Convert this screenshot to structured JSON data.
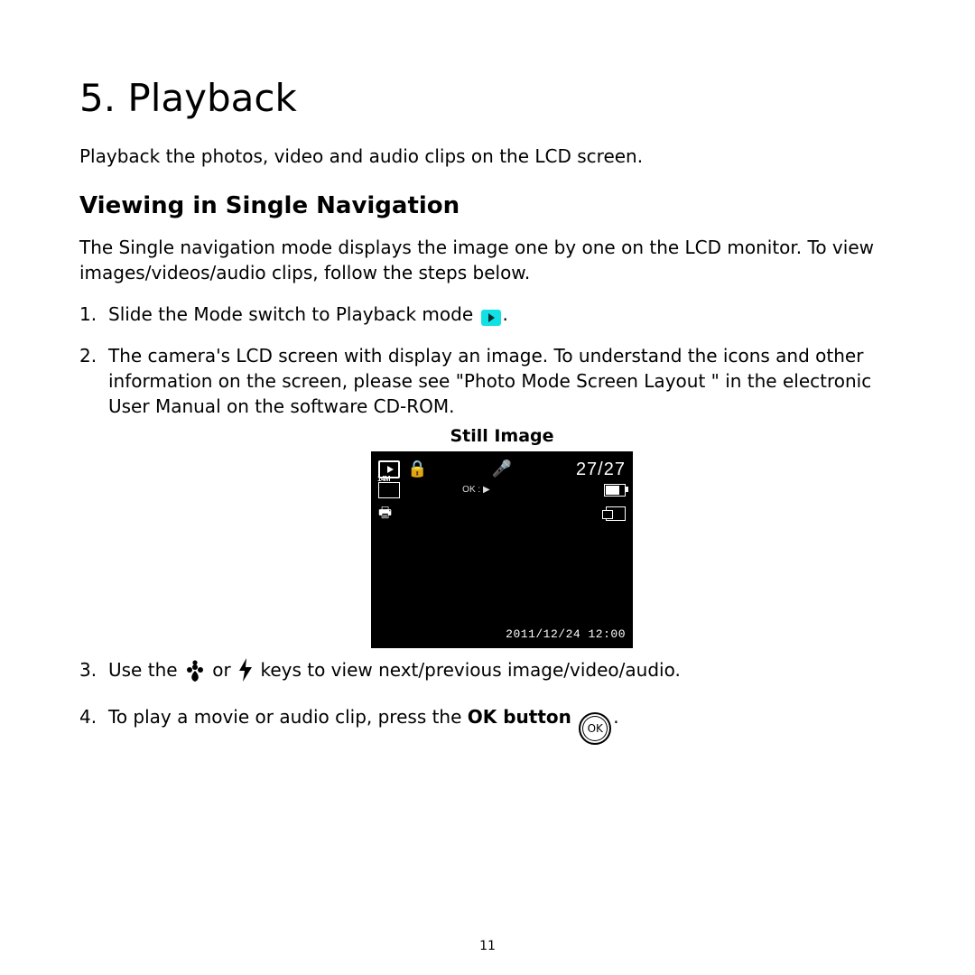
{
  "title": "5. Playback",
  "intro": "Playback the photos, video and audio clips on the LCD screen.",
  "subhead": "Viewing in Single Navigation",
  "desc": "The Single navigation mode displays the image one by one on the LCD monitor.  To view images/videos/audio clips, follow the steps below.",
  "steps": {
    "s1a": "Slide the Mode switch to Playback mode ",
    "s1b": ".",
    "s2": "The camera's LCD screen with display an image. To understand the icons and other information on the screen, please see \"Photo Mode Screen Layout \" in the electronic User Manual on the software CD-ROM.",
    "s3a": "Use the ",
    "s3b": " or ",
    "s3c": " keys to view next/previous image/video/audio.",
    "s4a": "To play a movie or audio clip, press the ",
    "s4b": "OK button",
    "s4c": " ",
    "s4d": "."
  },
  "caption": "Still Image",
  "lcd": {
    "counter": "27/27",
    "res": "14M",
    "ok_hint": "OK : ▶",
    "timestamp": "2011/12/24 12:00"
  },
  "ok_label": "OK",
  "page_number": "11"
}
